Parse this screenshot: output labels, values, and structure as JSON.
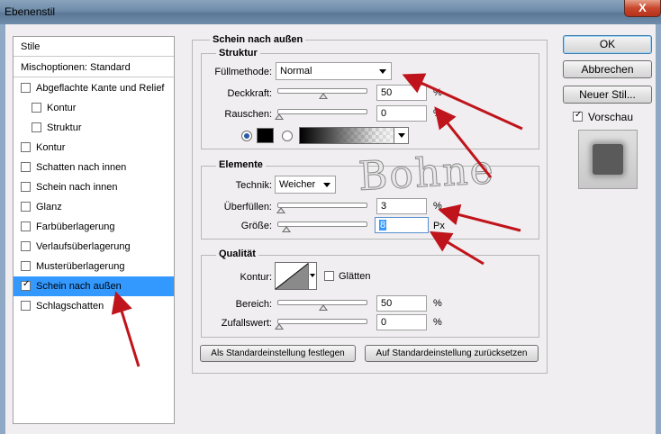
{
  "window": {
    "title": "Ebenenstil",
    "close_label": "X"
  },
  "styles_panel": {
    "header": "Stile",
    "blend_options": "Mischoptionen: Standard",
    "items": [
      {
        "label": "Abgeflachte Kante und Relief",
        "checked": false
      },
      {
        "label": "Kontur",
        "checked": false
      },
      {
        "label": "Struktur",
        "checked": false
      },
      {
        "label": "Kontur",
        "checked": false
      },
      {
        "label": "Schatten nach innen",
        "checked": false
      },
      {
        "label": "Schein nach innen",
        "checked": false
      },
      {
        "label": "Glanz",
        "checked": false
      },
      {
        "label": "Farbüberlagerung",
        "checked": false
      },
      {
        "label": "Verlaufsüberlagerung",
        "checked": false
      },
      {
        "label": "Musterüberlagerung",
        "checked": false
      },
      {
        "label": "Schein nach außen",
        "checked": true,
        "selected": true
      },
      {
        "label": "Schlagschatten",
        "checked": false
      }
    ]
  },
  "main": {
    "title": "Schein nach außen",
    "structure": {
      "title": "Struktur",
      "blend_mode_label": "Füllmethode:",
      "blend_mode_value": "Normal",
      "opacity_label": "Deckkraft:",
      "opacity_value": "50",
      "opacity_unit": "%",
      "opacity_level": 0.5,
      "noise_label": "Rauschen:",
      "noise_value": "0",
      "noise_unit": "%",
      "noise_level": 0
    },
    "elements": {
      "title": "Elemente",
      "technique_label": "Technik:",
      "technique_value": "Weicher",
      "spread_label": "Überfüllen:",
      "spread_value": "3",
      "spread_unit": "%",
      "spread_level": 0.03,
      "size_label": "Größe:",
      "size_value": "8",
      "size_unit": "Px",
      "size_level": 0.03
    },
    "quality": {
      "title": "Qualität",
      "contour_label": "Kontur:",
      "antialias_label": "Glätten",
      "antialias_checked": false,
      "range_label": "Bereich:",
      "range_value": "50",
      "range_unit": "%",
      "range_level": 0.5,
      "jitter_label": "Zufallswert:",
      "jitter_value": "0",
      "jitter_unit": "%",
      "jitter_level": 0
    },
    "set_default_button": "Als Standardeinstellung festlegen",
    "reset_default_button": "Auf Standardeinstellung zurücksetzen"
  },
  "actions": {
    "ok": "OK",
    "cancel": "Abbrechen",
    "new_style": "Neuer Stil...",
    "preview_label": "Vorschau",
    "preview_checked": true
  },
  "watermark": "Bohne",
  "colors": {
    "selection": "#3399ff",
    "arrow": "#c0141c",
    "glow_color": "#000000"
  }
}
